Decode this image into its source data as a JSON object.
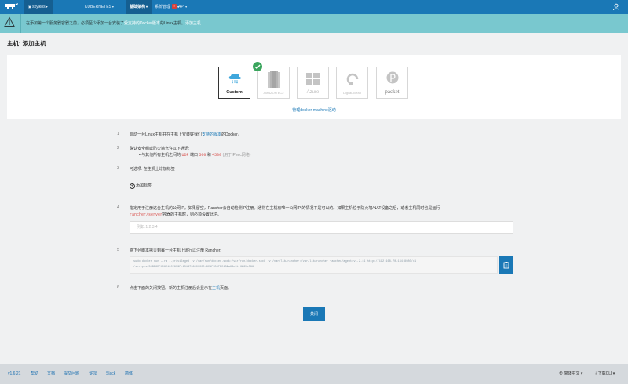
{
  "nav": {
    "env": "sxylk8s",
    "kubernetes": "KUBERNETES",
    "infra": "基础架构",
    "admin": "系统管理",
    "admin_badge": "!",
    "api": "API"
  },
  "banner": {
    "part1": "在添加第一个服务器容器之前，必须至少添加一台安装了",
    "highlight": "受支持的Docker版本",
    "part2": "的Linux主机。",
    "link": "添加主机"
  },
  "page_title": "主机: 添加主机",
  "drivers": [
    {
      "label": "Custom",
      "icon": "cloud-icon",
      "selected": true
    },
    {
      "label": "AMAZON EC2",
      "icon": "amazon-ec2-icon",
      "selected": false
    },
    {
      "label": "Azure",
      "icon": "azure-icon",
      "selected": false
    },
    {
      "label": "DigitalOcean",
      "icon": "digitalocean-icon",
      "selected": false
    },
    {
      "label": "packet",
      "icon": "packet-icon",
      "selected": false
    }
  ],
  "manage_machine_link": "管理docker-machine驱动",
  "steps": {
    "s1": {
      "num": "1",
      "pre": "启动一台Linux主机并在主机上安装好我们",
      "link": "支持的版本",
      "post": "的Docker。"
    },
    "s2": {
      "num": "2",
      "text": "确认安全组或防火墙允许以下通讯:",
      "bullet_pre": "• 与其他所有主机之间的",
      "udp": "UDP",
      "ports_word": "端口",
      "p500": "500",
      "and": "和",
      "p4500": "4500",
      "note": "(用于IPsec网络)"
    },
    "s3": {
      "num": "3",
      "text": "可选项: 在主机上增加标签",
      "add_label": "添加标签"
    },
    "s4": {
      "num": "4",
      "line1": "指定用于注册这台主机的公网IP。如果留空，Rancher会自动检测IP注册。通常在主机有唯一公网IP 的情况下是可以的。如果主机位于防火墙/NAT设备之后，或者主机同时也是运行",
      "code": "rancher/server",
      "line2": "容器的主机时，则必须设置此IP。",
      "placeholder": "例如:1.2.3.4"
    },
    "s5": {
      "num": "5",
      "text": "将下列脚本拷贝到每一台主机上运行以注册 Rancher:",
      "command_line1": "sudo docker run --rm --privileged -v /var/run/docker.sock:/var/run/docker.sock -v /var/lib/rancher:/var/lib/rancher rancher/agent:v1.2.11 http://192.168.70.134:8080/v1",
      "command_line2": "/scripts/34BE6DF408C10C2879F:1514736000000:8C1F9D8FDC1B9a6Ge9LrKZ6Ue5G8"
    },
    "s6": {
      "num": "6",
      "pre": "点击下面的关闭按钮。新的主机注册后会显示在",
      "link": "主机",
      "post": "页面。"
    }
  },
  "close_button": "关闭",
  "footer": {
    "version": "v1.6.21",
    "help": "帮助",
    "docs": "文档",
    "issues": "提交问题",
    "forums": "论坛",
    "slack": "Slack",
    "english": "简体",
    "language": "简体中文",
    "download_cli": "下载CLI"
  },
  "colors": {
    "primary": "#1a78b6",
    "banner": "#79c8cf",
    "check": "#3aa55d"
  }
}
